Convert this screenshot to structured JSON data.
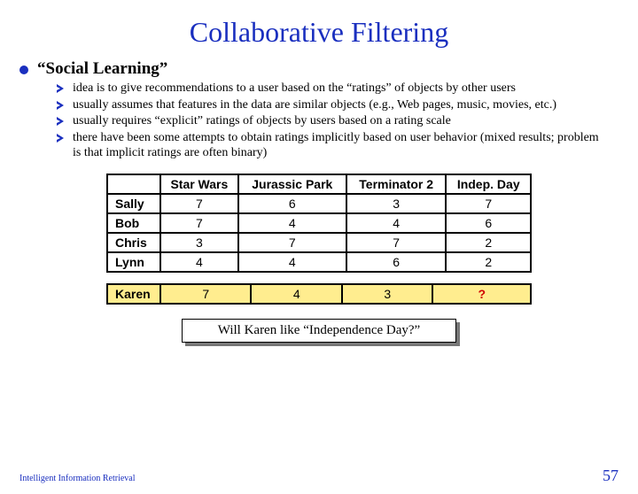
{
  "title": "Collaborative Filtering",
  "heading": "“Social Learning”",
  "bullets": {
    "b0": "idea is to give recommendations to a user based on the “ratings” of objects by other users",
    "b1": "usually assumes that features in the data are similar objects (e.g., Web pages, music, movies, etc.)",
    "b2": "usually requires “explicit” ratings of objects by users based on a rating scale",
    "b3": "there have been some attempts to obtain ratings implicitly based on user behavior (mixed results; problem is that implicit ratings are often binary)"
  },
  "chart_data": {
    "type": "table",
    "columns": [
      "Star Wars",
      "Jurassic Park",
      "Terminator 2",
      "Indep. Day"
    ],
    "rows": [
      {
        "name": "Sally",
        "values": [
          "7",
          "6",
          "3",
          "7"
        ]
      },
      {
        "name": "Bob",
        "values": [
          "7",
          "4",
          "4",
          "6"
        ]
      },
      {
        "name": "Chris",
        "values": [
          "3",
          "7",
          "7",
          "2"
        ]
      },
      {
        "name": "Lynn",
        "values": [
          "4",
          "4",
          "6",
          "2"
        ]
      }
    ],
    "query_row": {
      "name": "Karen",
      "values": [
        "7",
        "4",
        "3",
        "?"
      ]
    }
  },
  "caption": "Will Karen like “Independence Day?”",
  "footer_left": "Intelligent Information Retrieval",
  "footer_right": "57"
}
